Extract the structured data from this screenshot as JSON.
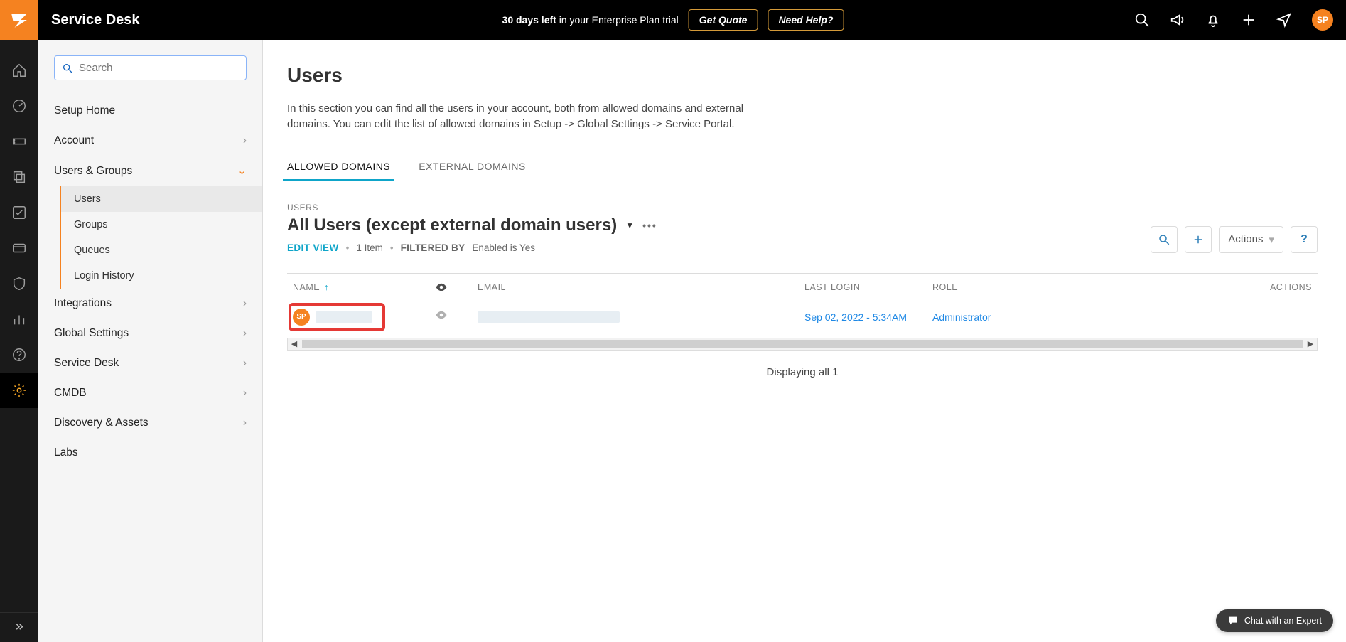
{
  "header": {
    "app_title": "Service Desk",
    "trial_bold": "30 days left",
    "trial_rest": " in your Enterprise Plan trial",
    "get_quote": "Get Quote",
    "need_help": "Need Help?",
    "avatar_initials": "SP"
  },
  "setup_sidebar": {
    "search_placeholder": "Search",
    "items": {
      "setup_home": "Setup Home",
      "account": "Account",
      "users_groups": "Users & Groups",
      "integrations": "Integrations",
      "global_settings": "Global Settings",
      "service_desk": "Service Desk",
      "cmdb": "CMDB",
      "discovery": "Discovery & Assets",
      "labs": "Labs"
    },
    "users_groups_sub": {
      "users": "Users",
      "groups": "Groups",
      "queues": "Queues",
      "login_history": "Login History"
    }
  },
  "main": {
    "title": "Users",
    "description": "In this section you can find all the users in your account, both from allowed domains and external domains. You can edit the list of allowed domains in Setup -> Global Settings -> Service Portal.",
    "tabs": {
      "allowed": "ALLOWED DOMAINS",
      "external": "EXTERNAL DOMAINS"
    },
    "panel": {
      "label": "USERS",
      "title": "All Users (except external domain users)",
      "edit_view": "EDIT VIEW",
      "item_count": "1 Item",
      "filtered_by": "FILTERED BY",
      "filter_text": "Enabled is   Yes",
      "actions_label": "Actions"
    },
    "columns": {
      "name": "NAME",
      "email": "EMAIL",
      "last_login": "LAST LOGIN",
      "role": "ROLE",
      "actions": "ACTIONS"
    },
    "row0": {
      "initials": "SP",
      "last_login": "Sep 02, 2022 - 5:34AM",
      "role": "Administrator"
    },
    "footer": "Displaying all 1"
  },
  "chat": {
    "label": "Chat with an Expert"
  }
}
